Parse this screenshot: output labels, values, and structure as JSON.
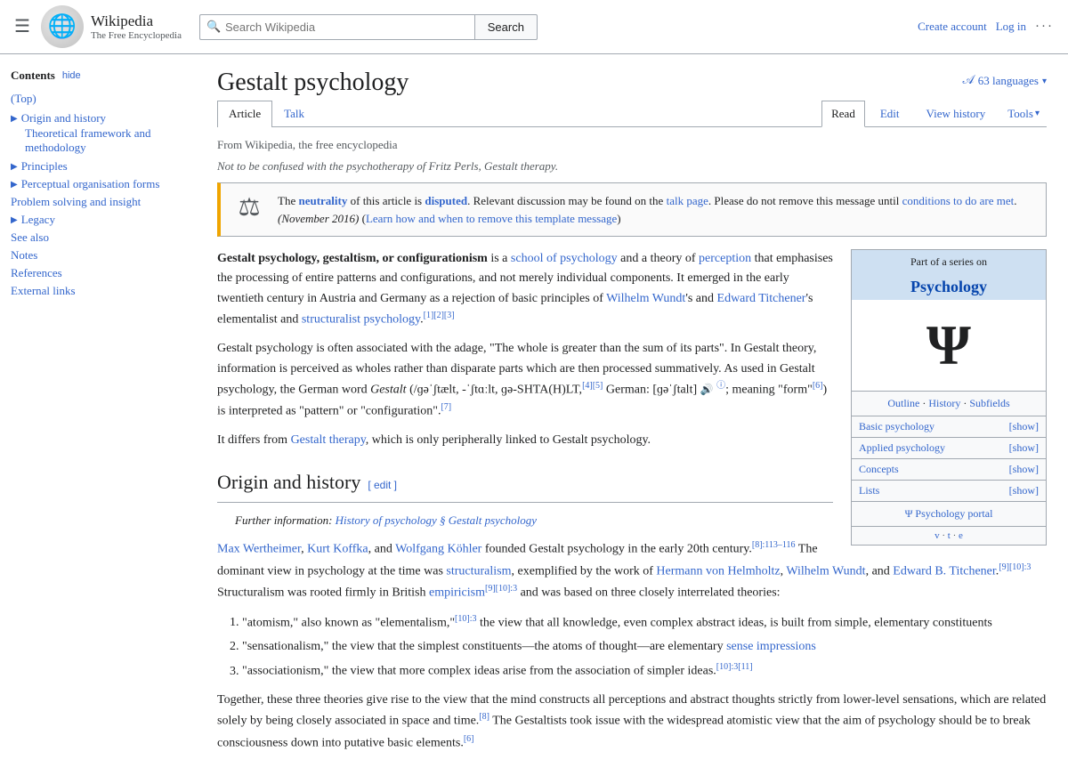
{
  "header": {
    "menu_label": "Menu",
    "logo_symbol": "🌐",
    "logo_title": "Wikipedia",
    "logo_subtitle": "The Free Encyclopedia",
    "search_placeholder": "Search Wikipedia",
    "search_button": "Search",
    "create_account": "Create account",
    "login": "Log in",
    "more_icon": "···"
  },
  "sidebar": {
    "contents_label": "Contents",
    "hide_label": "hide",
    "items": [
      {
        "label": "(Top)",
        "type": "top"
      },
      {
        "label": "Origin and history",
        "expandable": true
      },
      {
        "label": "Theoretical framework and methodology",
        "sub": true
      },
      {
        "label": "Principles",
        "expandable": true
      },
      {
        "label": "Perceptual organisation forms",
        "expandable": true
      },
      {
        "label": "Problem solving and insight",
        "plain": true
      },
      {
        "label": "Legacy",
        "expandable": true
      },
      {
        "label": "See also",
        "plain": true
      },
      {
        "label": "Notes",
        "plain": true
      },
      {
        "label": "References",
        "plain": true
      },
      {
        "label": "External links",
        "plain": true
      }
    ]
  },
  "page": {
    "title": "Gestalt psychology",
    "from_wiki": "From Wikipedia, the free encyclopedia",
    "lang_count": "63 languages",
    "tabs": [
      "Article",
      "Talk"
    ],
    "actions": [
      "Read",
      "Edit",
      "View history",
      "Tools"
    ],
    "hatnote": "Not to be confused with the psychotherapy of Fritz Perls, Gestalt therapy.",
    "notice": {
      "text_before": "The ",
      "neutrality": "neutrality",
      "text_mid1": " of this article is ",
      "disputed": "disputed",
      "text_mid2": ". Relevant discussion may be found on the ",
      "talk_page": "talk page",
      "text_mid3": ". Please do not remove this message until ",
      "conditions": "conditions to do are met",
      "text_mid4": ". (November 2016) (",
      "learn": "Learn how and when to remove this template message",
      "text_end": ")"
    },
    "intro": {
      "bold_terms": "Gestalt psychology, gestaltism, or configurationism",
      "text1": " is a ",
      "link1": "school of psychology",
      "text2": " and a theory of ",
      "link2": "perception",
      "text3": " that emphasises the processing of entire patterns and configurations, and not merely individual components. It emerged in the early twentieth century in Austria and Germany as a rejection of basic principles of ",
      "link3": "Wilhelm Wundt",
      "text4": "'s and ",
      "link4": "Edward Titchener",
      "text5": "'s elementalist and ",
      "link5": "structuralist psychology",
      "refs1": "[1][2][3]"
    },
    "para2": "Gestalt psychology is often associated with the adage, \"The whole is greater than the sum of its parts\". In Gestalt theory, information is perceived as wholes rather than disparate parts which are then processed summatively. As used in Gestalt psychology, the German word Gestalt (/ɡəˈʃtælt, -ˈʃtɑːlt, ɡə-SHTA(H)LT,[4][5] German: [ɡəˈʃtalt] ; meaning \"form\"[6]) is interpreted as \"pattern\" or \"configuration\".[7]",
    "para3_before": "It differs from ",
    "para3_link": "Gestalt therapy",
    "para3_after": ", which is only peripherally linked to Gestalt psychology.",
    "section_origin": "Origin and history",
    "edit_label": "[ edit ]",
    "further_info_label": "Further information: ",
    "further_info_link": "History of psychology § Gestalt psychology",
    "origin_text1": {
      "link1": "Max Wertheimer",
      "comma": ", ",
      "link2": "Kurt Koffka",
      "text1": ", and ",
      "link3": "Wolfgang Köhler",
      "text2": " founded Gestalt psychology in the early 20th century.",
      "ref1": "[8]:113–116",
      "text3": " The dominant view in psychology at the time was ",
      "link4": "structuralism",
      "text4": ", exemplified by the work of ",
      "link5": "Hermann von Helmholtz",
      "text5": ", ",
      "link6": "Wilhelm Wundt",
      "text6": ", and ",
      "link7": "Edward B. Titchener",
      "ref2": "[9][10]:3",
      "text7": " Structuralism was rooted firmly in British ",
      "link8": "empiricism",
      "ref3": "[9][10]:3",
      "text8": " and was based on three closely interrelated theories:"
    },
    "theories": [
      {
        "text": "\"atomism,\" also known as \"elementalism,\"",
        "ref": "[10]:3",
        "rest": " the view that all knowledge, even complex abstract ideas, is built from simple, elementary constituents"
      },
      {
        "text": "\"sensationalism,\" the view that the simplest constituents—the atoms of thought—are elementary ",
        "link": "sense impressions",
        "rest": ""
      },
      {
        "text": "\"associationism,\" the view that more complex ideas arise from the association of simpler ideas.",
        "ref": "[10]:3[11]",
        "rest": ""
      }
    ],
    "para_together": "Together, these three theories give rise to the view that the mind constructs all perceptions and abstract thoughts strictly from lower-level sensations, which are related solely by being closely associated in space and time.",
    "ref_together": "[8]",
    "para_together2": " The Gestaltists took issue with the widespread atomistic view that the aim of psychology should be to break consciousness down into putative basic elements.",
    "ref_together2": "[6]"
  },
  "infobox": {
    "series_label": "Part of a series on",
    "title": "Psychology",
    "symbol": "Ψ",
    "outline": "Outline",
    "history": "History",
    "subfields": "Subfields",
    "rows": [
      {
        "label": "Basic psychology",
        "action": "[show]"
      },
      {
        "label": "Applied psychology",
        "action": "[show]"
      },
      {
        "label": "Concepts",
        "action": "[show]"
      },
      {
        "label": "Lists",
        "action": "[show]"
      }
    ],
    "portal_label": "Ψ Psychology portal",
    "footer_links": "v · t · e"
  }
}
